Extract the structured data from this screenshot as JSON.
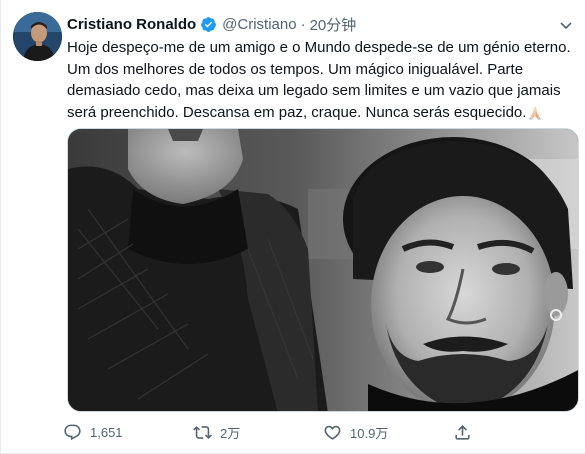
{
  "user": {
    "display_name": "Cristiano Ronaldo",
    "handle": "@Cristiano",
    "separator": "·",
    "time": "20分钟"
  },
  "tweet": {
    "text": "Hoje despeço-me de um amigo e o Mundo despede-se de um génio eterno. Um dos melhores de todos os tempos. Um mágico inigualável. Parte demasiado cedo, mas deixa um legado sem limites e um vazio que jamais será preenchido. Descansa em paz, craque. Nunca serás esquecido.",
    "emoji": "folded-hands-emoji"
  },
  "actions": {
    "reply_count": "1,651",
    "retweet_count": "2万",
    "like_count": "10.9万"
  },
  "colors": {
    "verified": "#1d9bf0",
    "secondary_text": "#536471",
    "primary_text": "#0f1419"
  }
}
